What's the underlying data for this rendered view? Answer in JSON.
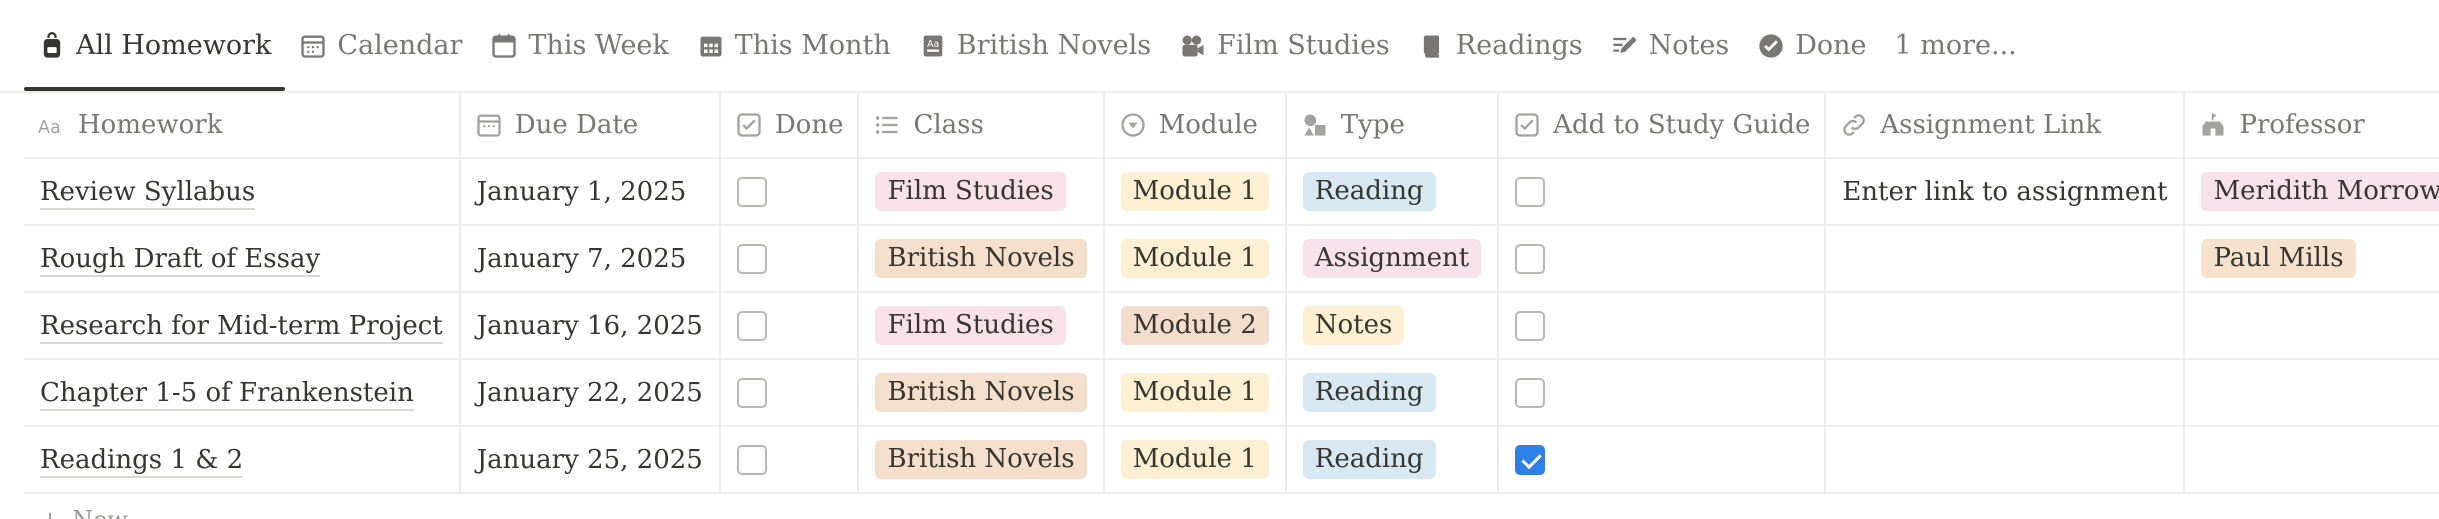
{
  "tabs": [
    {
      "label": "All Homework",
      "icon": "backpack-icon",
      "active": true
    },
    {
      "label": "Calendar",
      "icon": "calendar-icon"
    },
    {
      "label": "This Week",
      "icon": "calendar-week-icon"
    },
    {
      "label": "This Month",
      "icon": "calendar-month-icon"
    },
    {
      "label": "British Novels",
      "icon": "book-icon"
    },
    {
      "label": "Film Studies",
      "icon": "camera-icon"
    },
    {
      "label": "Readings",
      "icon": "notebook-icon"
    },
    {
      "label": "Notes",
      "icon": "pencil-lines-icon"
    },
    {
      "label": "Done",
      "icon": "check-circle-icon"
    },
    {
      "label": "1 more...",
      "icon": ""
    }
  ],
  "columns": [
    {
      "label": "Homework",
      "icon": "text-icon"
    },
    {
      "label": "Due Date",
      "icon": "calendar-icon"
    },
    {
      "label": "Done",
      "icon": "checkbox-icon"
    },
    {
      "label": "Class",
      "icon": "list-icon"
    },
    {
      "label": "Module",
      "icon": "select-icon"
    },
    {
      "label": "Type",
      "icon": "shapes-icon"
    },
    {
      "label": "Add to Study Guide",
      "icon": "checkbox-icon"
    },
    {
      "label": "Assignment Link",
      "icon": "link-icon"
    },
    {
      "label": "Professor",
      "icon": "school-icon"
    }
  ],
  "colors": {
    "pink": "#f9e2ec",
    "orange": "#f4e0d0",
    "yellow": "#fbf0d0",
    "brown": "#f0ddd0",
    "blue": "#d9e8f2",
    "rose": "#f5e1ea",
    "peach": "#f7e5d2",
    "accent": "#2f80e6"
  },
  "rows": [
    {
      "homework": "Review Syllabus",
      "due_date": "January 1, 2025",
      "done": false,
      "class": {
        "label": "Film Studies",
        "color": "#f9e1ea"
      },
      "module": {
        "label": "Module 1",
        "color": "#fcefd2"
      },
      "type": {
        "label": "Reading",
        "color": "#d8e8f2"
      },
      "study_guide": false,
      "assignment_link": "Enter link to assignment",
      "professor": {
        "label": "Meridith Morrow",
        "color": "#f7e1ea"
      }
    },
    {
      "homework": "Rough Draft of Essay",
      "due_date": "January 7, 2025",
      "done": false,
      "class": {
        "label": "British Novels",
        "color": "#f4dfcc"
      },
      "module": {
        "label": "Module 1",
        "color": "#fcefd2"
      },
      "type": {
        "label": "Assignment",
        "color": "#f7e1ea"
      },
      "study_guide": false,
      "assignment_link": "",
      "professor": {
        "label": "Paul Mills",
        "color": "#f6e1cd"
      }
    },
    {
      "homework": "Research for Mid-term Project",
      "due_date": "January 16, 2025",
      "done": false,
      "class": {
        "label": "Film Studies",
        "color": "#f9e1ea"
      },
      "module": {
        "label": "Module 2",
        "color": "#f2dccb"
      },
      "type": {
        "label": "Notes",
        "color": "#fcefd2"
      },
      "study_guide": false,
      "assignment_link": "",
      "professor": null
    },
    {
      "homework": "Chapter 1-5 of Frankenstein",
      "due_date": "January 22, 2025",
      "done": false,
      "class": {
        "label": "British Novels",
        "color": "#f4dfcc"
      },
      "module": {
        "label": "Module 1",
        "color": "#fcefd2"
      },
      "type": {
        "label": "Reading",
        "color": "#d8e8f2"
      },
      "study_guide": false,
      "assignment_link": "",
      "professor": null
    },
    {
      "homework": "Readings 1 & 2",
      "due_date": "January 25, 2025",
      "done": false,
      "class": {
        "label": "British Novels",
        "color": "#f4dfcc"
      },
      "module": {
        "label": "Module 1",
        "color": "#fcefd2"
      },
      "type": {
        "label": "Reading",
        "color": "#d8e8f2"
      },
      "study_guide": true,
      "assignment_link": "",
      "professor": null
    }
  ],
  "new_row_label": "New"
}
